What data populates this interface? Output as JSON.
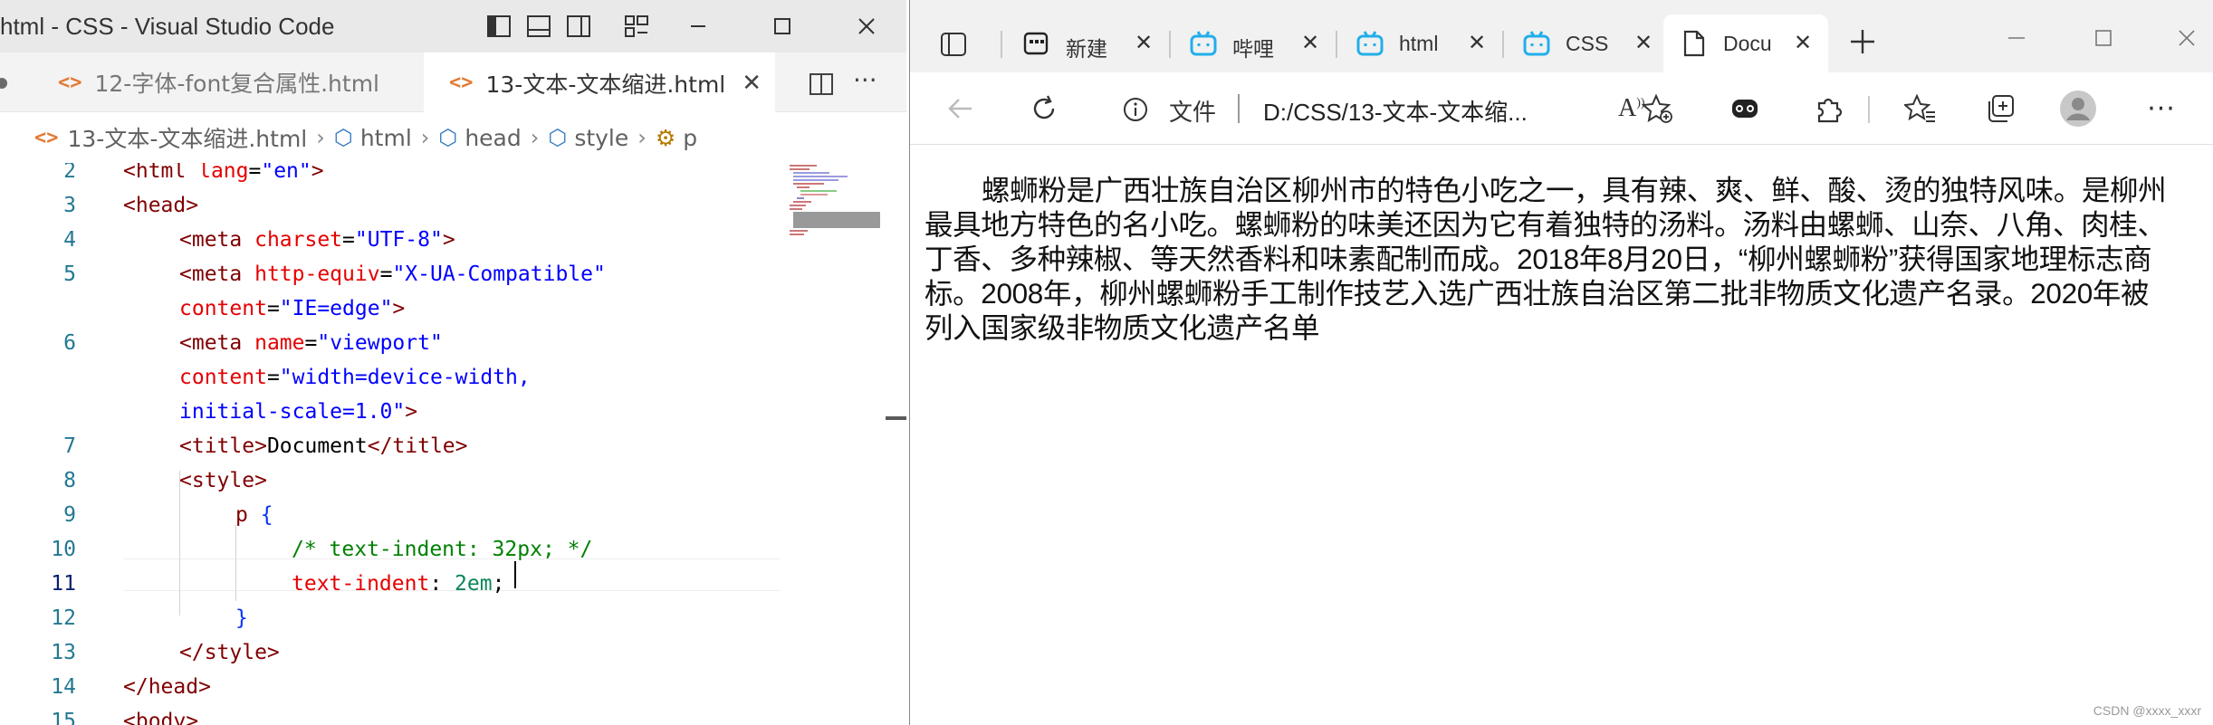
{
  "vscode": {
    "title": "html - CSS - Visual Studio Code",
    "tabs": [
      {
        "label": "12-字体-font复合属性.html",
        "icon": "html-file-icon",
        "active": false
      },
      {
        "label": "13-文本-文本缩进.html",
        "icon": "html-file-icon",
        "active": true
      }
    ],
    "breadcrumb": [
      "13-文本-文本缩进.html",
      "html",
      "head",
      "style",
      "p"
    ],
    "line_numbers": [
      "2",
      "3",
      "4",
      "5",
      "",
      "6",
      "",
      "7",
      "8",
      "9",
      "10",
      "11",
      "12",
      "13",
      "14",
      "15"
    ],
    "code": {
      "l2_a": "<html ",
      "l2_b": "lang",
      "l2_c": "=",
      "l2_d": "\"en\"",
      "l2_e": ">",
      "l3": "<head>",
      "l4_a": "<meta ",
      "l4_b": "charset",
      "l4_c": "=",
      "l4_d": "\"UTF-8\"",
      "l4_e": ">",
      "l5_a": "<meta ",
      "l5_b": "http-equiv",
      "l5_c": "=",
      "l5_d": "\"X-UA-Compatible\"",
      "l5w_a": "content",
      "l5w_b": "=",
      "l5w_c": "\"IE=edge\"",
      "l5w_d": ">",
      "l6_a": "<meta ",
      "l6_b": "name",
      "l6_c": "=",
      "l6_d": "\"viewport\"",
      "l6w_a": "content",
      "l6w_b": "=",
      "l6w_c": "\"width=device-width,",
      "l6w2_a": "initial-scale=1.0\"",
      "l6w2_b": ">",
      "l7_a": "<title>",
      "l7_b": "Document",
      "l7_c": "</title>",
      "l8": "<style>",
      "l9_a": "p ",
      "l9_b": "{",
      "l10": "/* text-indent: 32px; */",
      "l11_a": "text-indent",
      "l11_b": ": ",
      "l11_c": "2em",
      "l11_d": ";",
      "l12": "}",
      "l13": "</style>",
      "l14": "</head>",
      "l15": "<body>"
    },
    "active_line": "11"
  },
  "edge": {
    "tabs": [
      {
        "label": "新建",
        "icon": "new-tab-icon"
      },
      {
        "label": "哔哩",
        "icon": "bilibili-icon"
      },
      {
        "label": "html",
        "icon": "bilibili-icon"
      },
      {
        "label": "CSS",
        "icon": "bilibili-icon"
      },
      {
        "label": "Docu",
        "icon": "document-icon",
        "active": true
      }
    ],
    "address": {
      "scheme": "文件",
      "url": "D:/CSS/13-文本-文本缩..."
    },
    "page": {
      "paragraph": "螺蛳粉是广西壮族自治区柳州市的特色小吃之一，具有辣、爽、鲜、酸、烫的独特风味。是柳州最具地方特色的名小吃。螺蛳粉的味美还因为它有着独特的汤料。汤料由螺蛳、山奈、八角、肉桂、丁香、多种辣椒、等天然香料和味素配制而成。2018年8月20日，“柳州螺蛳粉”获得国家地理标志商标。2008年，柳州螺蛳粉手工制作技艺入选广西壮族自治区第二批非物质文化遗产名录。2020年被列入国家级非物质文化遗产名单"
    },
    "watermark": "CSDN @xxxx_xxxr"
  },
  "colors": {
    "vscode_titlebar": "#e9e9e9",
    "edge_tabbar": "#f1f1f1",
    "bilibili_blue": "#23aeea",
    "html_file_icon": "#e37933"
  }
}
